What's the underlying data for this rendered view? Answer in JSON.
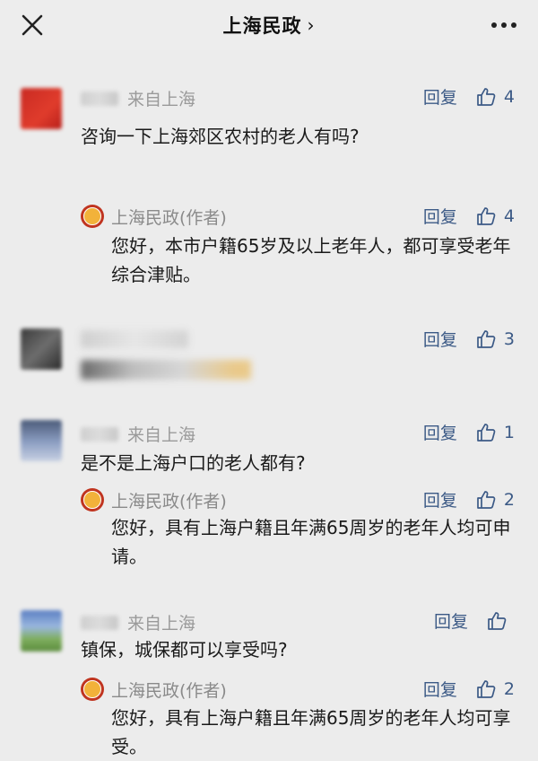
{
  "header": {
    "title": "上海民政",
    "chevron": "›"
  },
  "labels": {
    "reply": "回复",
    "author_tag": "(作者)"
  },
  "comments": [
    {
      "location": "来自上海",
      "likes": "4",
      "text": "咨询一下上海郊区农村的老人有吗?",
      "reply": {
        "name": "上海民政",
        "likes": "4",
        "text": "您好，本市户籍65岁及以上老年人，都可享受老年综合津贴。"
      }
    },
    {
      "likes": "3"
    },
    {
      "location": "来自上海",
      "likes": "1",
      "text": "是不是上海户口的老人都有?",
      "reply": {
        "name": "上海民政",
        "likes": "2",
        "text": "您好，具有上海户籍且年满65周岁的老年人均可申请。"
      }
    },
    {
      "location": "来自上海",
      "likes": "",
      "text": "镇保，城保都可以享受吗?",
      "reply": {
        "name": "上海民政",
        "likes": "2",
        "text": "您好，具有上海户籍且年满65周岁的老年人均可享受。"
      }
    }
  ],
  "colors": {
    "link": "#3c5a86",
    "meta": "#9a9a9a",
    "background": "#ececec"
  }
}
